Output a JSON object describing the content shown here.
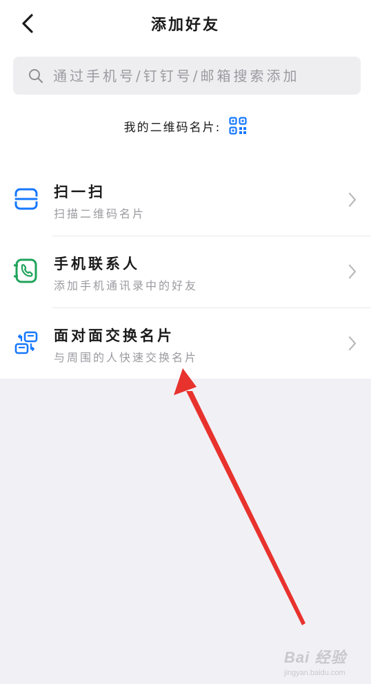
{
  "header": {
    "title": "添加好友",
    "back_icon": "back-arrow-icon"
  },
  "search": {
    "placeholder": "通过手机号/钉钉号/邮箱搜索添加",
    "value": "",
    "icon": "search-icon"
  },
  "qr_card": {
    "label": "我的二维码名片:",
    "icon": "qr-code-icon",
    "icon_color": "#1677ff"
  },
  "menu": {
    "items": [
      {
        "title": "扫一扫",
        "subtitle": "扫描二维码名片",
        "icon": "scan-icon",
        "color": "#1677ff"
      },
      {
        "title": "手机联系人",
        "subtitle": "添加手机通讯录中的好友",
        "icon": "phone-contacts-icon",
        "color": "#1fa35a"
      },
      {
        "title": "面对面交换名片",
        "subtitle": "与周围的人快速交换名片",
        "icon": "exchange-cards-icon",
        "color": "#1677ff"
      }
    ]
  },
  "annotation": {
    "arrow_color": "#e8322d"
  },
  "watermark": {
    "brand": "Bai 经验",
    "url": "jingyan.baidu.com"
  }
}
